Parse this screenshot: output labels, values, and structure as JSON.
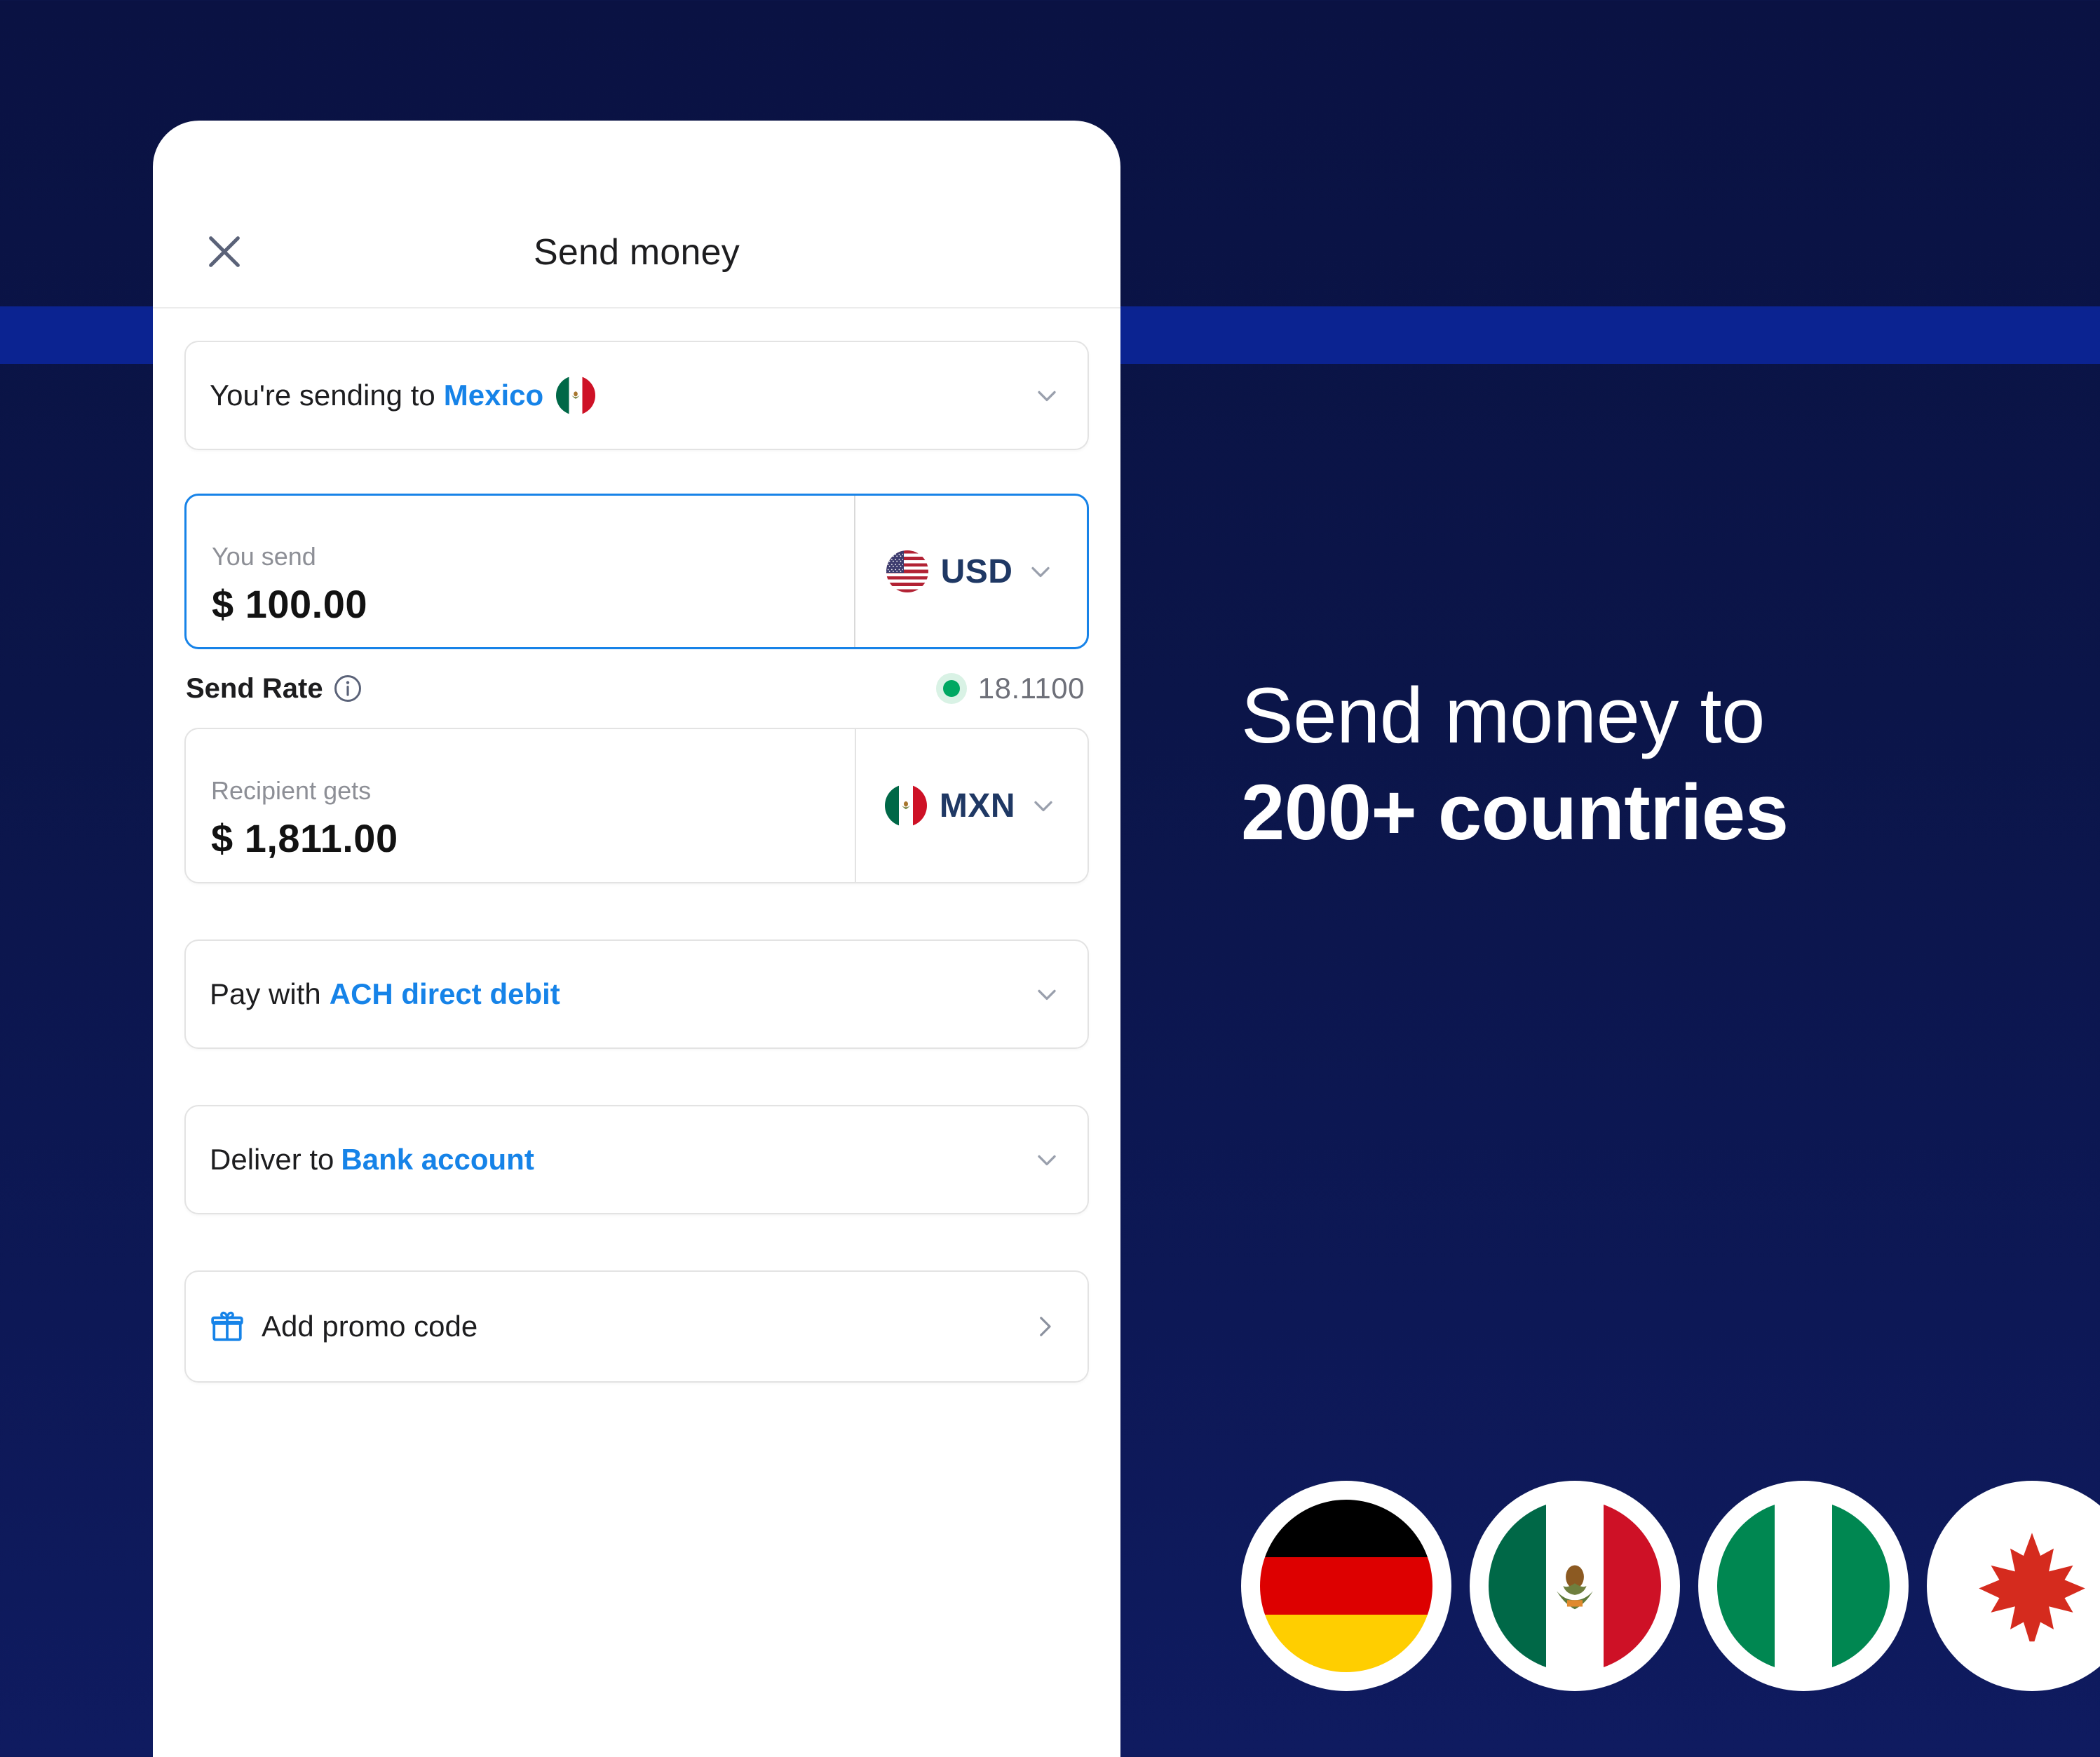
{
  "background": {
    "gradient_top": "#0a1243",
    "gradient_bottom": "#0f1b60",
    "stripe_color": "#0b2391"
  },
  "app": {
    "title": "Send money",
    "close_icon": "close-x-icon",
    "country_row": {
      "label": "You're sending to",
      "value": "Mexico",
      "flag": "mexico-flag",
      "chevron": "chevron-down-icon"
    },
    "you_send": {
      "caption": "You send",
      "value": "$ 100.00",
      "currency": "USD",
      "flag": "usa-flag",
      "chevron": "chevron-down-icon",
      "focused": true,
      "focus_color": "#1783e8"
    },
    "send_rate": {
      "label": "Send Rate",
      "info_icon": "info-circle-icon",
      "status_dot": "status-dot-green",
      "dot_color": "#00a862",
      "value": "18.1100"
    },
    "recipient_gets": {
      "caption": "Recipient gets",
      "value": "$ 1,811.00",
      "currency": "MXN",
      "flag": "mexico-flag",
      "chevron": "chevron-down-icon"
    },
    "pay_with": {
      "label": "Pay with",
      "value": "ACH direct debit",
      "chevron": "chevron-down-icon"
    },
    "deliver_to": {
      "label": "Deliver to",
      "value": "Bank account",
      "chevron": "chevron-down-icon"
    },
    "promo": {
      "icon": "gift-icon",
      "label": "Add promo code",
      "arrow": "chevron-right-icon"
    },
    "accent_blue": "#1683e8"
  },
  "marketing": {
    "headline_line1": "Send money to",
    "headline_line2": "200+ countries",
    "flags": [
      {
        "name": "germany-flag",
        "country": "Germany"
      },
      {
        "name": "mexico-flag",
        "country": "Mexico"
      },
      {
        "name": "nigeria-flag",
        "country": "Nigeria"
      },
      {
        "name": "canada-flag",
        "country": "Canada"
      }
    ]
  }
}
